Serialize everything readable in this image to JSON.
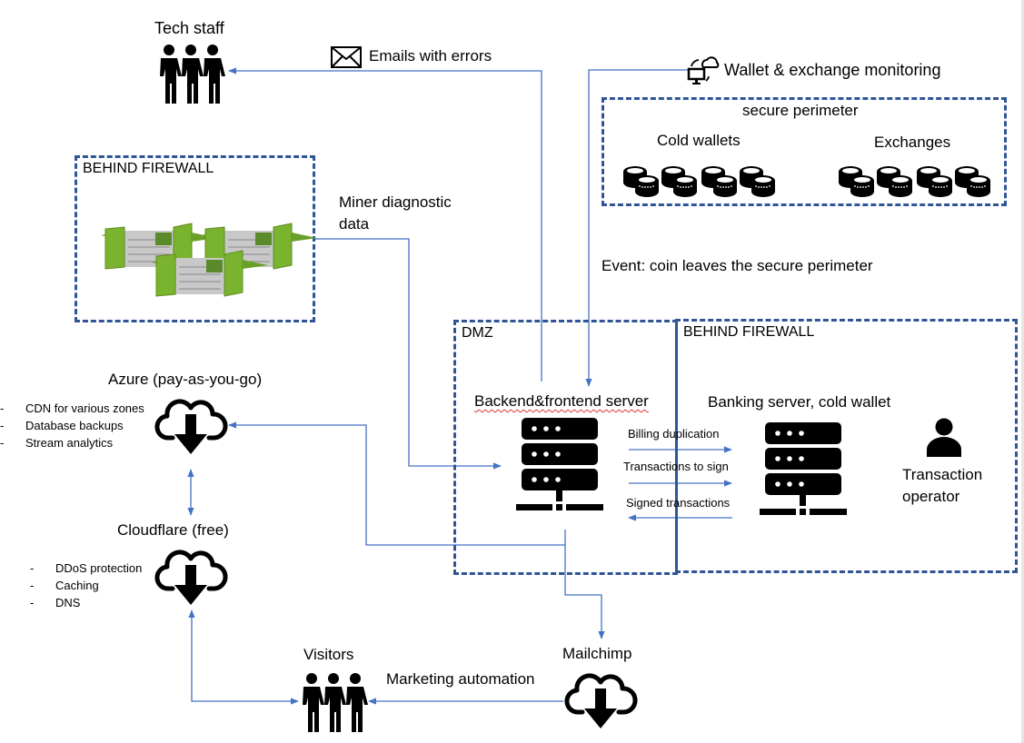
{
  "diagram": {
    "tech_staff": {
      "label": "Tech staff",
      "icon": "people-group-icon"
    },
    "emails": {
      "label": "Emails with errors",
      "icon": "envelope-icon"
    },
    "monitoring": {
      "label": "Wallet & exchange monitoring",
      "icon": "monitor-cloud-sync-icon"
    },
    "secure_perimeter": {
      "title": "secure perimeter",
      "cold_wallets": {
        "label": "Cold wallets",
        "icon": "coin-stacks-icon",
        "count": 4
      },
      "exchanges": {
        "label": "Exchanges",
        "icon": "coin-stacks-icon",
        "count": 4
      }
    },
    "miners_zone": {
      "title": "BEHIND FIREWALL",
      "icon": "mining-containers-image"
    },
    "miner_data": {
      "label_line1": "Miner diagnostic",
      "label_line2": "data"
    },
    "event": {
      "label": "Event: coin leaves the secure perimeter"
    },
    "dmz": {
      "title": "DMZ"
    },
    "banking_zone": {
      "title": "BEHIND FIREWALL"
    },
    "backend": {
      "label": "Backend&frontend server",
      "icon": "server-icon"
    },
    "banking": {
      "label": "Banking server, cold wallet",
      "icon": "server-icon"
    },
    "operator": {
      "label_line1": "Transaction",
      "label_line2": "operator",
      "icon": "user-icon"
    },
    "flows": {
      "billing": "Billing duplication",
      "to_sign": "Transactions to sign",
      "signed": "Signed transactions"
    },
    "azure": {
      "label": "Azure (pay-as-you-go)",
      "icon": "cloud-download-icon",
      "bullet": "-",
      "items": [
        "CDN for various zones",
        "Database backups",
        "Stream analytics"
      ]
    },
    "cloudflare": {
      "label": "Cloudflare (free)",
      "icon": "cloud-download-icon",
      "bullet": "-",
      "items": [
        "DDoS protection",
        "Caching",
        "DNS"
      ]
    },
    "visitors": {
      "label": "Visitors",
      "icon": "people-group-icon"
    },
    "marketing": {
      "label": "Marketing automation"
    },
    "mailchimp": {
      "label": "Mailchimp",
      "icon": "cloud-download-icon"
    },
    "colors": {
      "connector": "#4472c4",
      "zone_border": "#2f5597",
      "container_green": "#7ab32e"
    }
  }
}
